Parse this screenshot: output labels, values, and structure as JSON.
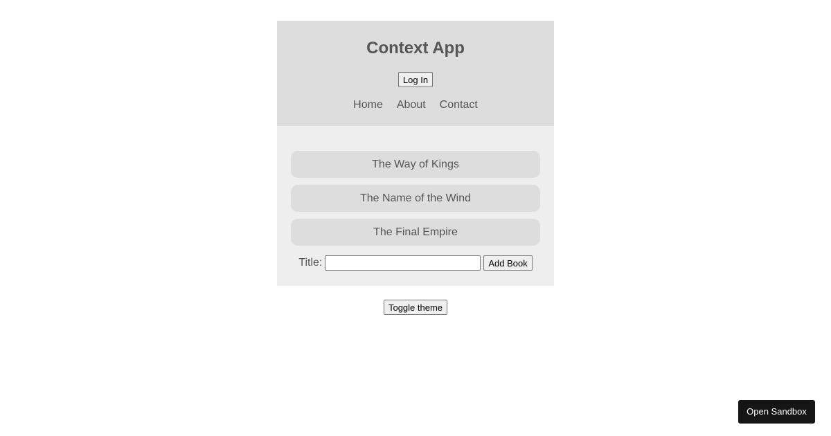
{
  "header": {
    "title": "Context App",
    "login_label": "Log In",
    "nav": [
      "Home",
      "About",
      "Contact"
    ]
  },
  "books": [
    "The Way of Kings",
    "The Name of the Wind",
    "The Final Empire"
  ],
  "form": {
    "title_label": "Title:",
    "title_value": "",
    "add_label": "Add Book"
  },
  "toggle_label": "Toggle theme",
  "sandbox_label": "Open Sandbox",
  "colors": {
    "header_bg": "#dddddd",
    "main_bg": "#eeeeee",
    "book_bg": "#dddddd",
    "text": "#555555",
    "sandbox_bg": "#151515"
  }
}
